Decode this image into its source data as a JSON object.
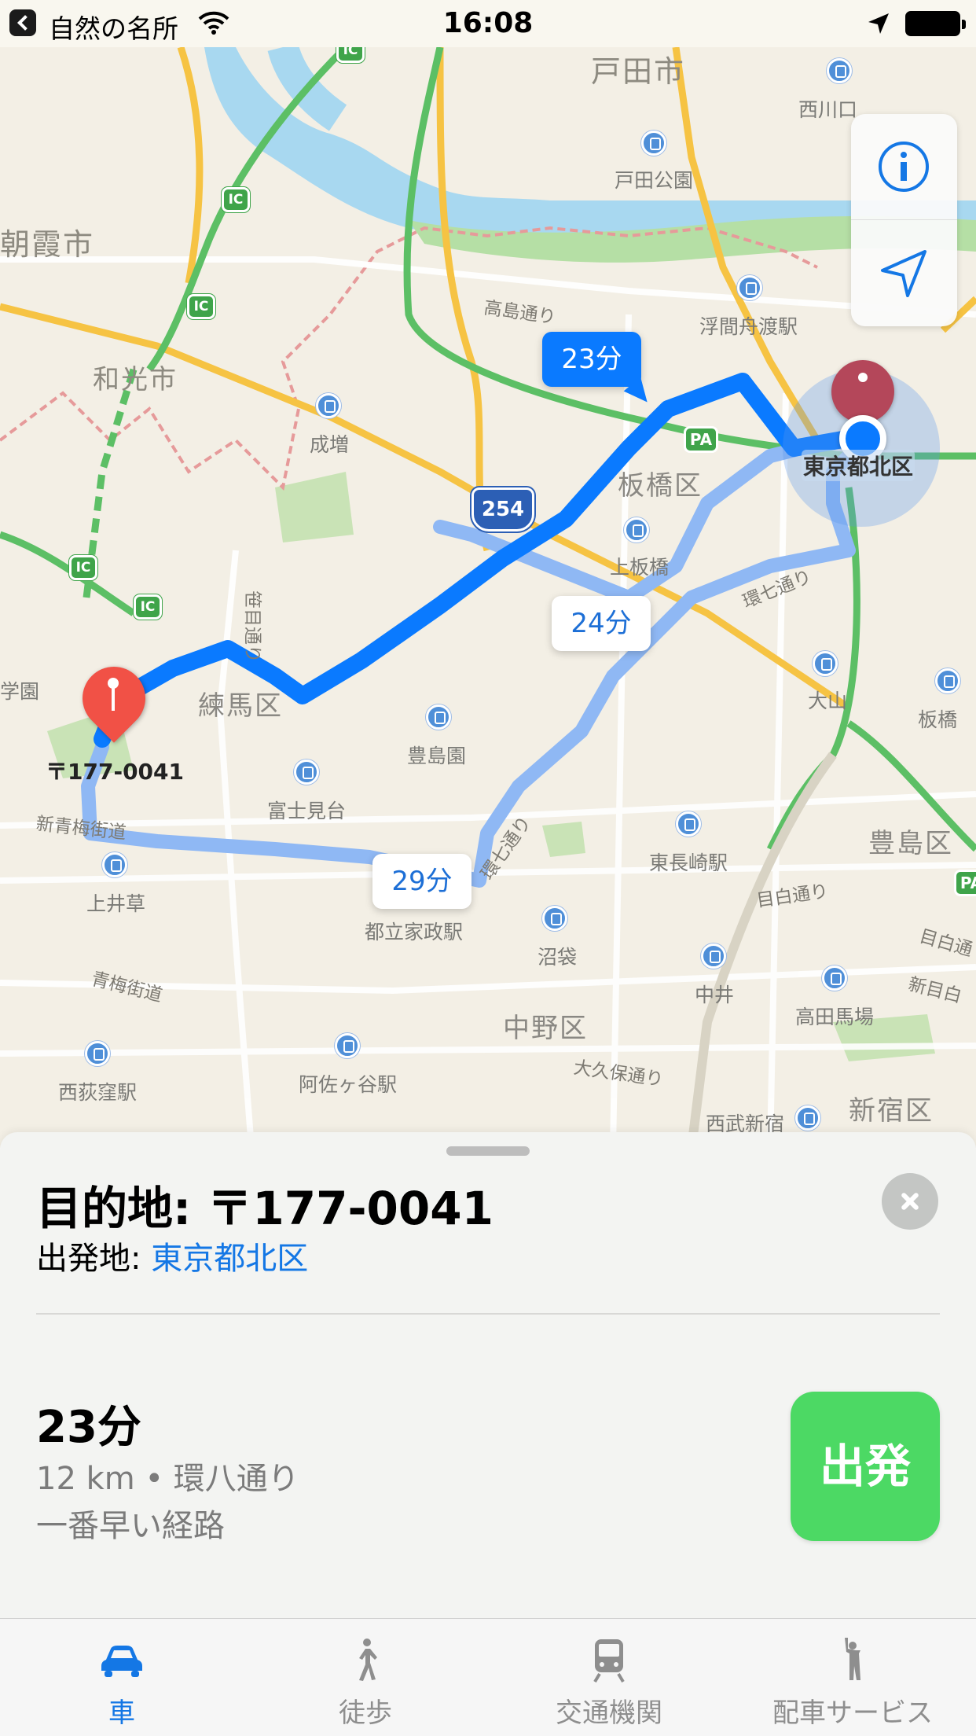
{
  "status_bar": {
    "back_app": "自然の名所",
    "time": "16:08"
  },
  "map": {
    "cities": [
      "朝霞市",
      "和光市",
      "戸田市"
    ],
    "wards": [
      "板橋区",
      "練馬区",
      "豊島区",
      "中野区",
      "新宿区"
    ],
    "current_location_label": "東京都北区",
    "destination_label": "〒177-0041",
    "route_times": {
      "primary": "23分",
      "alt1": "24分",
      "alt2": "29分"
    },
    "stations": [
      "西川口",
      "戸田公園",
      "浮間舟渡駅",
      "成増",
      "上板橋",
      "大山",
      "板橋",
      "豊島園",
      "富士見台",
      "東長崎駅",
      "上井草",
      "都立家政駅",
      "沼袋",
      "中井",
      "高田馬場",
      "西荻窪駅",
      "阿佐ヶ谷駅",
      "西武新宿",
      "学園"
    ],
    "roads": [
      "高島通り",
      "笹目通り",
      "環七通り",
      "新青梅街道",
      "青梅街道",
      "目白通り",
      "大久保通り",
      "新目白",
      "目白通"
    ],
    "route_shield": "254",
    "pa_badge": "PA",
    "ic_badge": "IC"
  },
  "sheet": {
    "destination_prefix": "目的地: ",
    "destination": "〒177-0041",
    "origin_prefix": "出発地: ",
    "origin": "東京都北区",
    "eta": "23分",
    "distance": "12 km",
    "via": "環八通り",
    "note": "一番早い経路",
    "go_label": "出発"
  },
  "tabs": [
    {
      "label": "車",
      "icon": "car-icon",
      "active": true
    },
    {
      "label": "徒歩",
      "icon": "walk-icon",
      "active": false
    },
    {
      "label": "交通機関",
      "icon": "train-icon",
      "active": false
    },
    {
      "label": "配車サービス",
      "icon": "ride-share-icon",
      "active": false
    }
  ],
  "colors": {
    "route_primary": "#0a7aff",
    "route_alt": "#8fb8f4",
    "go_button": "#4cd964",
    "link": "#1477e5"
  }
}
